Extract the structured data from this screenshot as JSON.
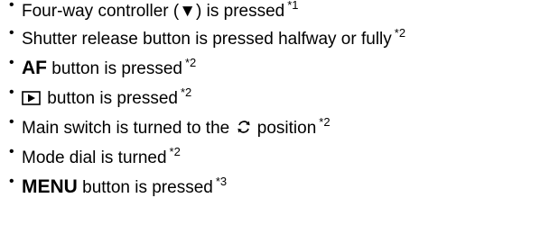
{
  "bullet": "•",
  "items": [
    {
      "text_before": "Four-way controller (",
      "symbol": "▼",
      "text_after": ") is pressed",
      "note": "*1"
    },
    {
      "text": "Shutter release button is pressed halfway or fully",
      "note": "*2"
    },
    {
      "bold": "AF",
      "text": " button is pressed",
      "note": "*2"
    },
    {
      "icon": "playback-icon",
      "text": " button is pressed",
      "note": "*2"
    },
    {
      "text_before": "Main switch is turned to the ",
      "icon": "restart-arrows-icon",
      "text_after": " position",
      "note": "*2"
    },
    {
      "text": "Mode dial is turned",
      "note": "*2"
    },
    {
      "bold": "MENU",
      "text": " button is pressed",
      "note": "*3"
    }
  ]
}
